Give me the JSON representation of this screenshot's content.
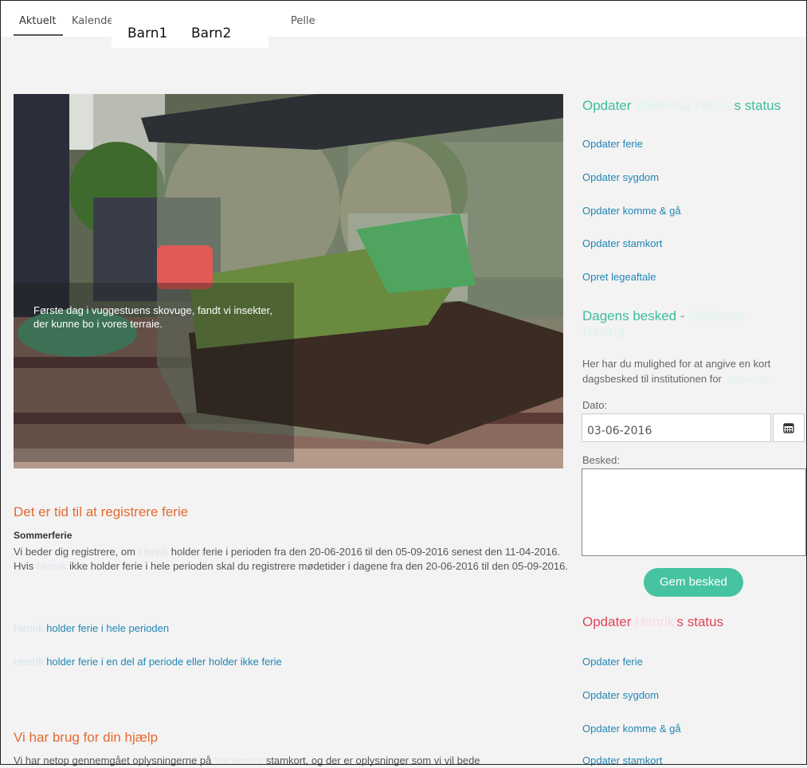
{
  "nav": {
    "tabs": [
      "Aktuelt",
      "Kalende",
      "Pelle"
    ],
    "overlay": [
      "Barn1",
      "Barn2"
    ]
  },
  "hero": {
    "caption": "Første dag i vuggestuens skovuge, fandt vi insekter, der kunne bo i vores terraie."
  },
  "main": {
    "ferie_heading": "Det er tid til at registrere ferie",
    "ferie_sub": "Sommerferie",
    "ferie_p1": "Vi beder dig registrere, om ",
    "ferie_name1": "Henrik",
    "ferie_p2": " holder ferie i perioden fra den 20-06-2016 til den 05-09-2016 senest den 11-04-2016. Hvis ",
    "ferie_name2": "Henrik",
    "ferie_p3": " ikke holder ferie i hele perioden skal du registrere mødetider i dagene fra den 20-06-2016 til den 05-09-2016.",
    "link1_name": "Henrik",
    "link1_text": " holder ferie i hele perioden",
    "link2_name": "Henrik",
    "link2_text": " holder ferie i en del af periode eller holder ikke ferie",
    "help_heading": "Vi har brug for din hjælp",
    "help_p1": "Vi har netop gennemgået oplysningerne på ",
    "help_name": "Valdemars",
    "help_p2": " stamkort, og der er oplysninger som vi vil bede"
  },
  "sidebar": {
    "status1_prefix": "Opdater ",
    "status1_name": "Valdemar Hasse",
    "status1_suffix": "s status",
    "links1": [
      "Opdater ferie",
      "Opdater sygdom",
      "Opdater komme & gå",
      "Opdater stamkort",
      "Opret legeaftale"
    ],
    "dagens_prefix": "Dagens besked - ",
    "dagens_name": "Valdemar",
    "dagens_name2": "Hasing",
    "dagens_text": "Her har du mulighed for at angive en kort dagsbesked til institutionen for ",
    "dagens_text_name": "Valdemar.",
    "dato_label": "Dato:",
    "dato_value": "03-06-2016",
    "besked_label": "Besked:",
    "save_button": "Gem besked",
    "status2_prefix": "Opdater ",
    "status2_name": "Henrik'",
    "status2_suffix": "s status",
    "links2": [
      "Opdater ferie",
      "Opdater sygdom",
      "Opdater komme & gå",
      "Opdater stamkort"
    ]
  }
}
